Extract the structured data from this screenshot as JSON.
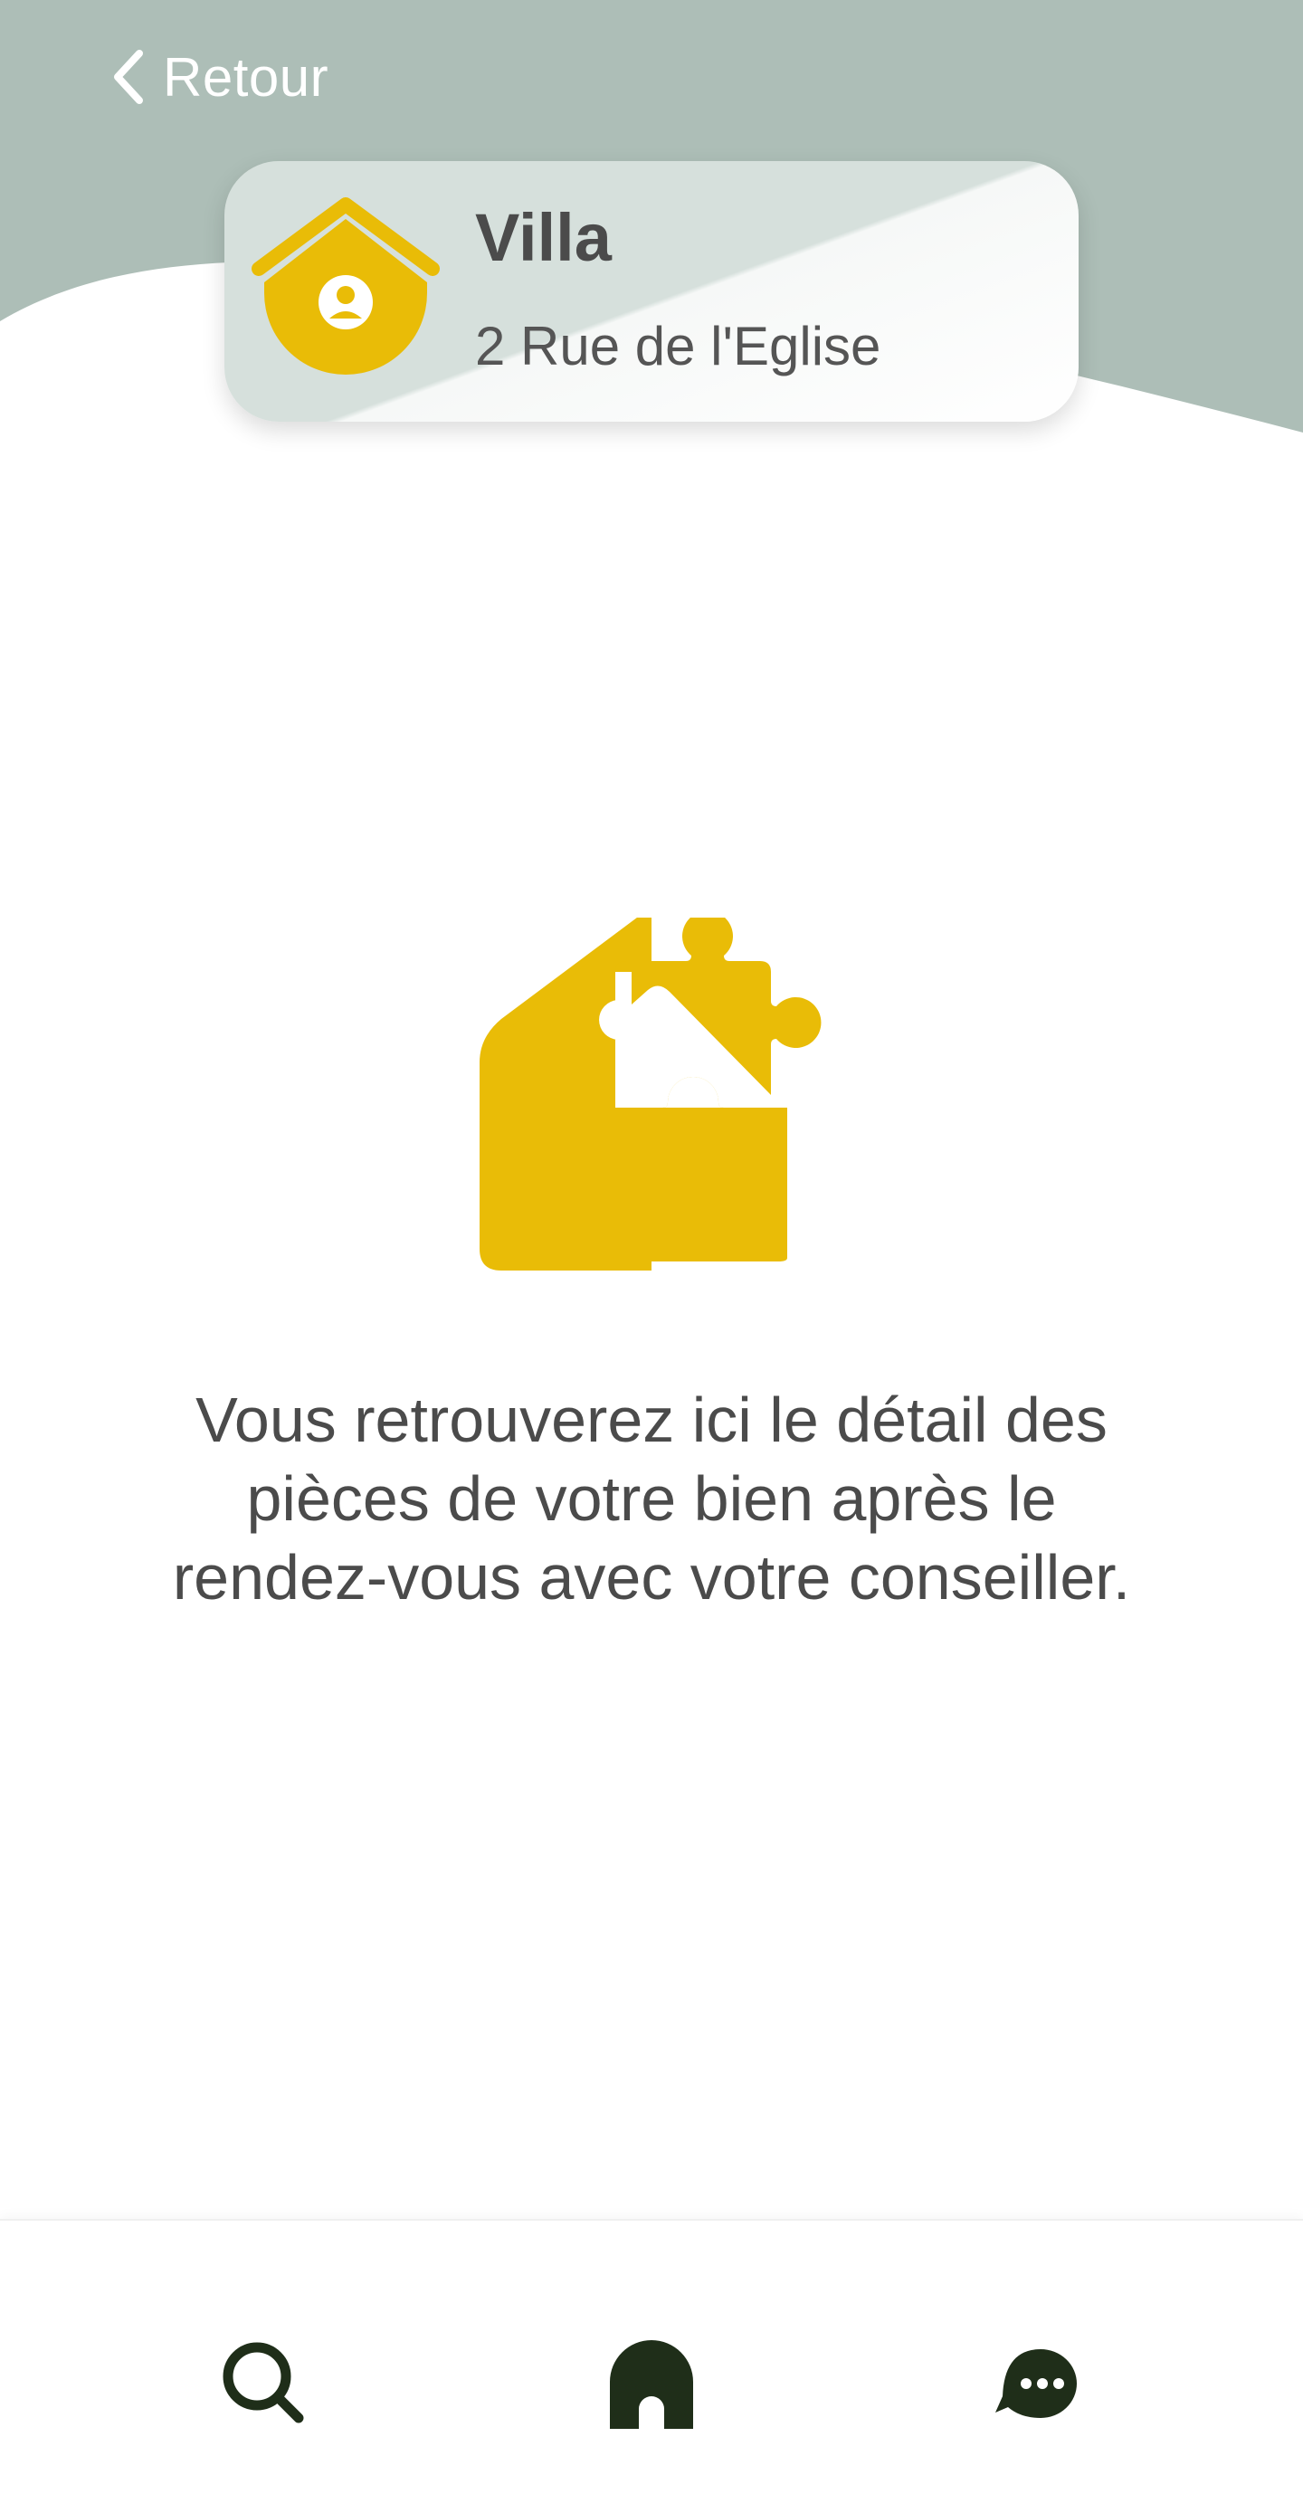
{
  "header": {
    "back_label": "Retour"
  },
  "property": {
    "title": "Villa",
    "address": "2 Rue de l'Eglise",
    "icon": "house-user-icon"
  },
  "empty_state": {
    "illustration": "house-puzzle-icon",
    "message": "Vous retrouverez ici le détail des pièces de votre bien après le rendez-vous avec votre conseiller."
  },
  "bottom_nav": {
    "items": [
      {
        "icon": "search-icon"
      },
      {
        "icon": "home-icon"
      },
      {
        "icon": "chat-icon"
      }
    ]
  },
  "colors": {
    "header_bg": "#adbeb7",
    "accent_yellow": "#e9bc07",
    "text_dark": "#4b4b4b",
    "nav_icon": "#1f2e19"
  }
}
